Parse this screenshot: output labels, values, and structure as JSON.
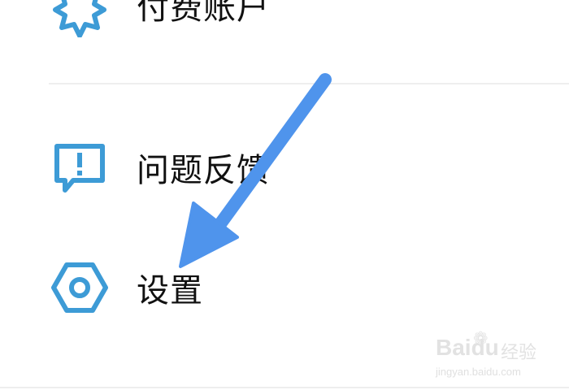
{
  "menu": {
    "items": [
      {
        "label": "付费账户",
        "icon": "badge-star-icon"
      },
      {
        "label": "问题反馈",
        "icon": "feedback-exclamation-icon"
      },
      {
        "label": "设置",
        "icon": "settings-hexagon-icon"
      }
    ]
  },
  "overlay": {
    "arrow_color": "#4f94ec",
    "icon_color": "#3d9bd6"
  },
  "watermark": {
    "brand": "Baidu",
    "brand_cn": "经验",
    "url": "jingyan.baidu.com"
  }
}
